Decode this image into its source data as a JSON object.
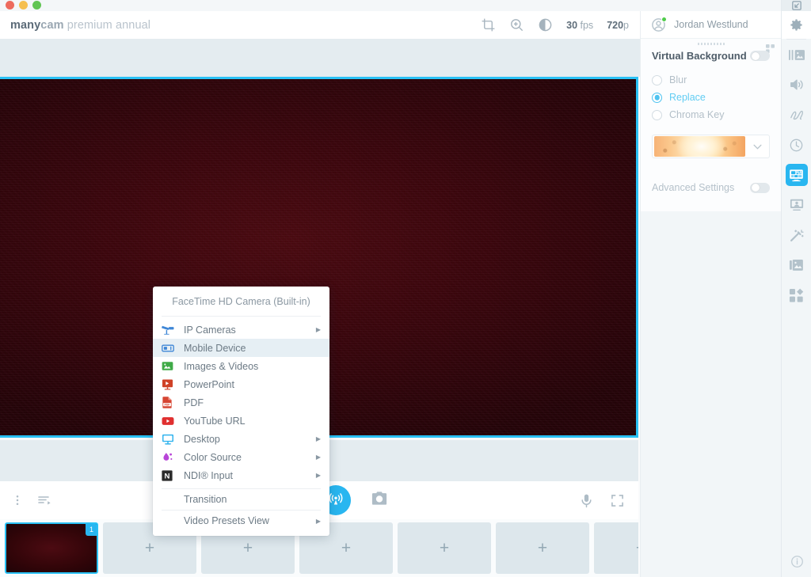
{
  "window": {
    "traffic_lights": [
      "close",
      "minimize",
      "maximize"
    ]
  },
  "topbar": {
    "brand_many": "many",
    "brand_cam": "cam",
    "brand_suffix": " premium annual",
    "icons": [
      "crop-icon",
      "zoom-in-icon",
      "brightness-icon"
    ],
    "fps_value": "30",
    "fps_label": " fps",
    "resolution_value": "720",
    "resolution_suffix": "p"
  },
  "right_panel": {
    "user_name": "Jordan Westlund",
    "title": "Virtual Background",
    "main_toggle": "off",
    "options": [
      {
        "label": "Blur",
        "selected": false
      },
      {
        "label": "Replace",
        "selected": true
      },
      {
        "label": "Chroma Key",
        "selected": false
      }
    ],
    "background_preview": "sunset-background-thumbnail",
    "advanced_label": "Advanced Settings",
    "advanced_toggle": "off"
  },
  "context_menu": {
    "header": "FaceTime HD Camera (Built-in)",
    "items": [
      {
        "label": "IP Cameras",
        "icon": "ip-camera-icon",
        "submenu": true,
        "hover": false
      },
      {
        "label": "Mobile Device",
        "icon": "mobile-device-icon",
        "submenu": false,
        "hover": true
      },
      {
        "label": "Images & Videos",
        "icon": "images-videos-icon",
        "submenu": false,
        "hover": false
      },
      {
        "label": "PowerPoint",
        "icon": "powerpoint-icon",
        "submenu": false,
        "hover": false
      },
      {
        "label": "PDF",
        "icon": "pdf-icon",
        "submenu": false,
        "hover": false
      },
      {
        "label": "YouTube URL",
        "icon": "youtube-icon",
        "submenu": false,
        "hover": false
      },
      {
        "label": "Desktop",
        "icon": "desktop-icon",
        "submenu": true,
        "hover": false
      },
      {
        "label": "Color Source",
        "icon": "color-source-icon",
        "submenu": true,
        "hover": false
      },
      {
        "label": "NDI® Input",
        "icon": "ndi-icon",
        "submenu": true,
        "hover": false
      }
    ],
    "transition": "Transition",
    "video_presets_view": "Video Presets View"
  },
  "control_bar": {
    "left_icons": [
      "more-options-icon",
      "playlist-icon"
    ],
    "broadcast": "broadcast-icon",
    "snapshot": "camera-snapshot-icon",
    "right_icons": [
      "microphone-icon",
      "fullscreen-icon"
    ]
  },
  "thumbnails": {
    "active_badge": "1",
    "add_label": "+",
    "next_label": "›",
    "slots": [
      {
        "type": "preset",
        "badge": "1"
      },
      {
        "type": "empty"
      },
      {
        "type": "empty"
      },
      {
        "type": "empty"
      },
      {
        "type": "empty"
      },
      {
        "type": "empty"
      },
      {
        "type": "empty"
      }
    ]
  },
  "rail": {
    "top_icon": "expand-window-icon",
    "items": [
      {
        "name": "settings-gear-icon",
        "active": false
      },
      {
        "name": "video-sources-icon",
        "active": false
      },
      {
        "name": "audio-icon",
        "active": false
      },
      {
        "name": "draw-icon",
        "active": false
      },
      {
        "name": "clock-icon",
        "active": false
      },
      {
        "name": "virtual-background-icon",
        "active": true
      },
      {
        "name": "lower-third-icon",
        "active": false
      },
      {
        "name": "effects-wand-icon",
        "active": false
      },
      {
        "name": "backgrounds-icon",
        "active": false
      },
      {
        "name": "widgets-icon",
        "active": false
      }
    ],
    "bottom_icon": "info-icon"
  },
  "colors": {
    "accent": "#29b6f0",
    "stage_border": "#29c1f5",
    "panel_bg": "#fcfdfe",
    "strip_bg": "#e4ecf0",
    "menu_hover": "#e6eff4"
  }
}
